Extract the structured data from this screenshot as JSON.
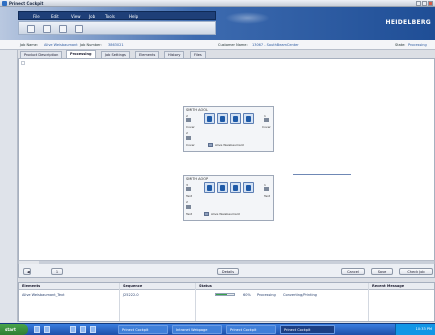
{
  "window": {
    "title": "Prinect Cockpit"
  },
  "menu": [
    "File",
    "Edit",
    "View",
    "Job",
    "Tools",
    "Help"
  ],
  "toolbar": {
    "icons": [
      "home-icon",
      "jobs-icon",
      "print-icon",
      "delete-icon"
    ]
  },
  "brand": "HEIDELBERG",
  "job": {
    "name_label": "Job Name:",
    "name_value": "Alive Weisbaumant",
    "number_label": "Job Number:",
    "number_value": "3863021",
    "customer_label": "Customer Name:",
    "customer_value": "13067 - SouthBeamCenter",
    "state_label": "State:",
    "state_value": "Processing"
  },
  "tabs": [
    "Product Description",
    "Processing",
    "Job Settings",
    "Elements",
    "History",
    "Files"
  ],
  "active_tab": "Processing",
  "cards": [
    {
      "title": "SMITH AOOL",
      "rows": [
        {
          "left": "Cover",
          "right": "Cover"
        },
        {
          "left": "Cover",
          "name": "Alive Weisbaumant"
        }
      ],
      "numbers": [
        "2",
        "1",
        "2"
      ]
    },
    {
      "title": "SMITH AOOP",
      "rows": [
        {
          "left": "Text",
          "right": "Text"
        },
        {
          "left": "Text",
          "name": "Alive Weisbaumant"
        }
      ],
      "numbers": [
        "3",
        "1",
        "2"
      ]
    }
  ],
  "bottom": {
    "page_field": "1",
    "details_button": "Details",
    "cancel_button": "Cancel",
    "save_button": "Save",
    "check_button": "Check Job"
  },
  "status_table": {
    "headers": [
      "Elements",
      "Sequence",
      "Status",
      "Recent Message"
    ],
    "rows": [
      {
        "element": "Alive Weisbaumant_Text",
        "sequence": "J25222-0",
        "progress_label": "60%",
        "progress": 0.6,
        "status_text": "Processing",
        "status_detail": "Converting/Printing"
      }
    ]
  },
  "taskbar": {
    "start": "start",
    "items": [
      "Prinect Cockpit",
      "Intranet Webpage",
      "Prinect Cockpit",
      "Prinect Cockpit"
    ],
    "active_index": 3,
    "clock": "10:33 PM"
  }
}
